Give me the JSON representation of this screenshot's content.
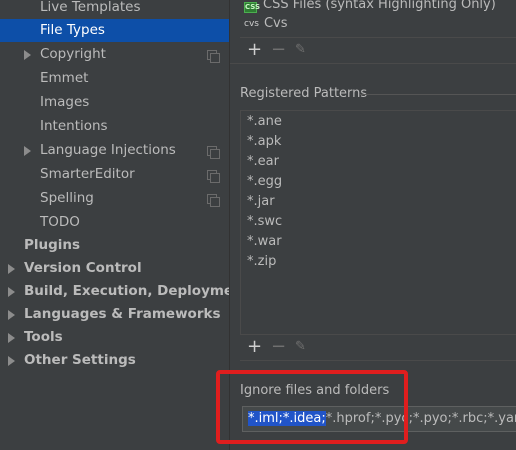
{
  "sidebar": {
    "items": [
      {
        "label": "Live Templates",
        "level": 2,
        "selected": false,
        "expandable": false,
        "copy_icon": false,
        "bold": false
      },
      {
        "label": "File Types",
        "level": 2,
        "selected": true,
        "expandable": false,
        "copy_icon": false,
        "bold": false
      },
      {
        "label": "Copyright",
        "level": 2,
        "selected": false,
        "expandable": true,
        "copy_icon": true,
        "bold": false
      },
      {
        "label": "Emmet",
        "level": 2,
        "selected": false,
        "expandable": false,
        "copy_icon": false,
        "bold": false
      },
      {
        "label": "Images",
        "level": 2,
        "selected": false,
        "expandable": false,
        "copy_icon": false,
        "bold": false
      },
      {
        "label": "Intentions",
        "level": 2,
        "selected": false,
        "expandable": false,
        "copy_icon": false,
        "bold": false
      },
      {
        "label": "Language Injections",
        "level": 2,
        "selected": false,
        "expandable": true,
        "copy_icon": true,
        "bold": false
      },
      {
        "label": "SmarterEditor",
        "level": 2,
        "selected": false,
        "expandable": false,
        "copy_icon": true,
        "bold": false
      },
      {
        "label": "Spelling",
        "level": 2,
        "selected": false,
        "expandable": false,
        "copy_icon": true,
        "bold": false
      },
      {
        "label": "TODO",
        "level": 2,
        "selected": false,
        "expandable": false,
        "copy_icon": false,
        "bold": false
      },
      {
        "label": "Plugins",
        "level": 1,
        "selected": false,
        "expandable": false,
        "copy_icon": false,
        "bold": true
      },
      {
        "label": "Version Control",
        "level": 1,
        "selected": false,
        "expandable": true,
        "copy_icon": false,
        "bold": true
      },
      {
        "label": "Build, Execution, Deployment",
        "level": 1,
        "selected": false,
        "expandable": true,
        "copy_icon": false,
        "bold": true
      },
      {
        "label": "Languages & Frameworks",
        "level": 1,
        "selected": false,
        "expandable": true,
        "copy_icon": false,
        "bold": true
      },
      {
        "label": "Tools",
        "level": 1,
        "selected": false,
        "expandable": true,
        "copy_icon": false,
        "bold": true
      },
      {
        "label": "Other Settings",
        "level": 1,
        "selected": false,
        "expandable": true,
        "copy_icon": false,
        "bold": true
      }
    ]
  },
  "file_types": {
    "items": [
      {
        "icon": "css-icon",
        "icon_text": "CSS",
        "label": "CSS Files (syntax Highlighting Only)"
      },
      {
        "icon": "cvs-icon",
        "icon_text": "cvs",
        "label": "Cvs"
      }
    ]
  },
  "toolbar": {
    "add": "+",
    "remove": "−",
    "edit": "✎"
  },
  "registered_patterns": {
    "title": "Registered Patterns",
    "items": [
      "*.ane",
      "*.apk",
      "*.ear",
      "*.egg",
      "*.jar",
      "*.swc",
      "*.war",
      "*.zip"
    ]
  },
  "ignore": {
    "title": "Ignore files and folders",
    "selected_text": "*.iml;*.idea;",
    "rest_text": "*.hprof;*.pyc;*.pyo;*.rbc;*.yarb;*~;.DS_Store;.git;"
  },
  "colors": {
    "selection": "#0d4fa8",
    "highlight_box": "#e01e1e",
    "text_selection": "#2154c8"
  }
}
